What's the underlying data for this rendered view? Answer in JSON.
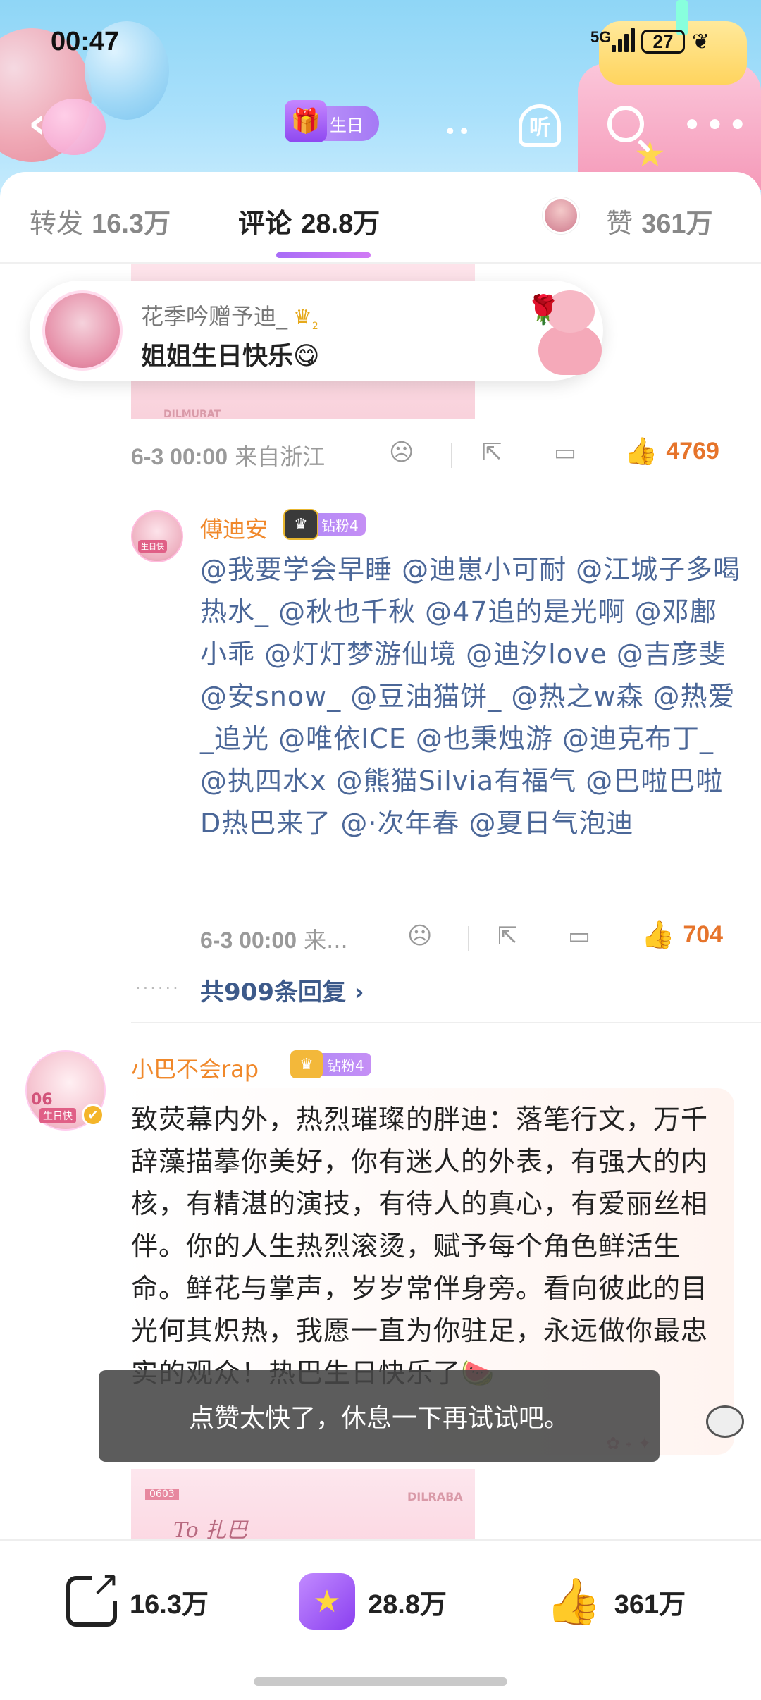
{
  "status_bar": {
    "time": "00:47",
    "network": "5G",
    "battery": "27"
  },
  "header": {
    "birthday_badge": "生日",
    "listen_label": "听"
  },
  "tabs": {
    "repost_label": "转发",
    "repost_count": "16.3万",
    "comment_label": "评论",
    "comment_count": "28.8万",
    "like_label": "赞",
    "like_count": "361万",
    "active": "comment"
  },
  "gift_card": {
    "sender": "花季吟赠予迪_",
    "message": "姐姐生日快乐😋",
    "badge_level": "2"
  },
  "top_photo": {
    "watermark": "DILMURAT"
  },
  "comment1_actions": {
    "time": "6-3 00:00",
    "location": "来自浙江",
    "likes": "4769"
  },
  "reply": {
    "nickname": "傅迪安",
    "fan_badge": "钻粉4",
    "text": "@我要学会早睡 @迪崽小可耐 @江城子多喝热水_ @秋也千秋 @47追的是光啊 @邓鄌小乖 @灯灯梦游仙境 @迪汐love @吉彦斐 @安snow_ @豆油猫饼_ @热之w森 @热爱_追光 @唯依ICE @也秉烛游 @迪克布丁_ @执四水x @熊猫Silvia有福气 @巴啦巴啦D热巴来了 @·次年春 @夏日气泡迪",
    "time": "6-3 00:00",
    "location": "来...",
    "likes": "704",
    "avatar_tag": "生日快"
  },
  "more_replies": "共909条回复 ›",
  "comment2": {
    "nickname": "小巴不会rap",
    "fan_badge": "钻粉4",
    "avatar_number": "06",
    "avatar_tag": "生日快",
    "text": "致荧幕内外，热烈璀璨的胖迪：落笔行文，万千辞藻描摹你美好，你有迷人的外表，有强大的内核，有精湛的演技，有待人的真心，有爱丽丝相伴。你的人生热烈滚烫，赋予每个角色鲜活生命。鲜花与掌声，岁岁常伴身旁。看向彼此的目光何其炽热，我愿一直为你驻足，永远做你最忠实的观众！热巴生日快乐了🍉"
  },
  "bottom_photo": {
    "date": "0603",
    "watermark": "DILRABA",
    "script": "To 扎巴"
  },
  "toast": "点赞太快了，休息一下再试试吧。",
  "bottom_bar": {
    "repost_count": "16.3万",
    "comment_count": "28.8万",
    "like_count": "361万"
  },
  "icons": {
    "accent_purple": "#a86df7",
    "like_orange": "#e6742b",
    "link_blue": "#4b6798"
  }
}
